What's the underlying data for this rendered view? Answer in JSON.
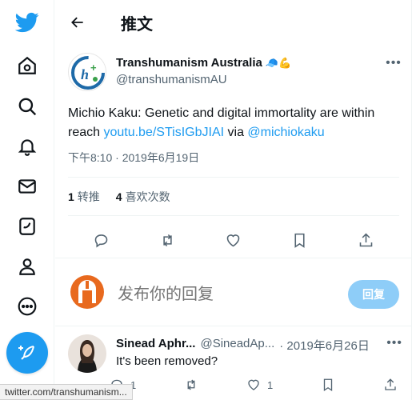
{
  "header": {
    "title": "推文"
  },
  "tweet": {
    "display_name": "Transhumanism Australia",
    "name_emojis": "🧢💪",
    "handle": "@transhumanismAU",
    "text_plain": "Michio Kaku: Genetic and digital immortality are within reach ",
    "link": "youtu.be/STisIGbJIAI",
    "via": " via ",
    "mention": "@michiokaku",
    "timestamp": "下午8:10 · 2019年6月19日",
    "stats": {
      "retweets_count": "1",
      "retweets_label": "转推",
      "likes_count": "4",
      "likes_label": "喜欢次数"
    }
  },
  "reply_box": {
    "placeholder": "发布你的回复",
    "button_label": "回复"
  },
  "reply_tweet": {
    "display_name": "Sinead Aphr...",
    "handle": "@SineadAp...",
    "date": "· 2019年6月26日",
    "text": "It's been removed?",
    "reply_count": "1",
    "like_count": "1"
  },
  "status_bar": {
    "url": "twitter.com/transhumanism..."
  },
  "colors": {
    "accent": "#1d9bf0",
    "muted": "#536471"
  }
}
